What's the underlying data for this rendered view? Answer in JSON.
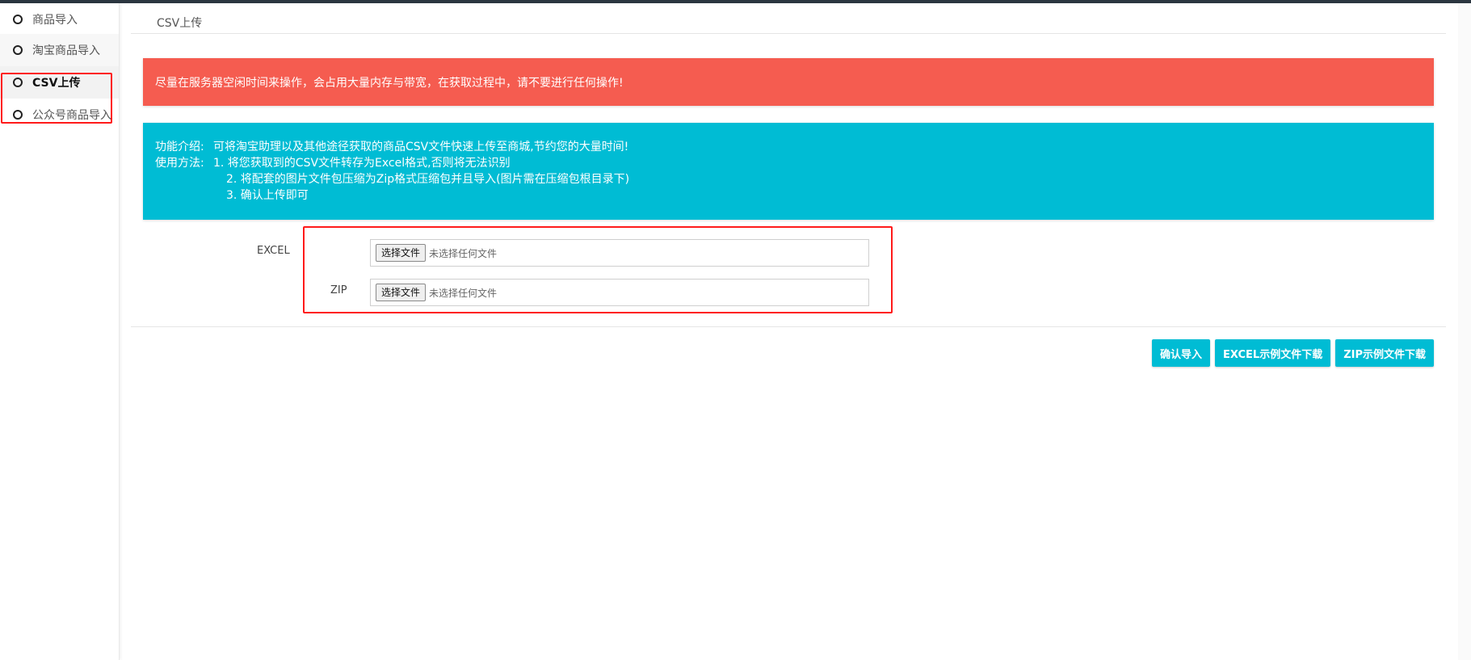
{
  "sidebar": {
    "items": [
      {
        "label": "商品导入"
      },
      {
        "label": "淘宝商品导入"
      },
      {
        "label": "CSV上传"
      },
      {
        "label": "公众号商品导入"
      }
    ]
  },
  "page": {
    "title": "CSV上传"
  },
  "alerts": {
    "warning": "尽量在服务器空闲时间来操作，会占用大量内存与带宽，在获取过程中，请不要进行任何操作!",
    "info": {
      "intro_label": "功能介绍:",
      "intro_text": "可将淘宝助理以及其他途径获取的商品CSV文件快速上传至商城,节约您的大量时间!",
      "usage_label": "使用方法:",
      "steps": [
        "1. 将您获取到的CSV文件转存为Excel格式,否则将无法识别",
        "2. 将配套的图片文件包压缩为Zip格式压缩包并且导入(图片需在压缩包根目录下)",
        "3. 确认上传即可"
      ]
    }
  },
  "form": {
    "excel": {
      "label": "EXCEL",
      "button": "选择文件",
      "status": "未选择任何文件"
    },
    "zip": {
      "label": "ZIP",
      "button": "选择文件",
      "status": "未选择任何文件"
    }
  },
  "actions": {
    "confirm": "确认导入",
    "excel_sample": "EXCEL示例文件下载",
    "zip_sample": "ZIP示例文件下载"
  },
  "colors": {
    "danger": "#f55c50",
    "info": "#00bcd4",
    "highlight": "#ff1a1a"
  }
}
